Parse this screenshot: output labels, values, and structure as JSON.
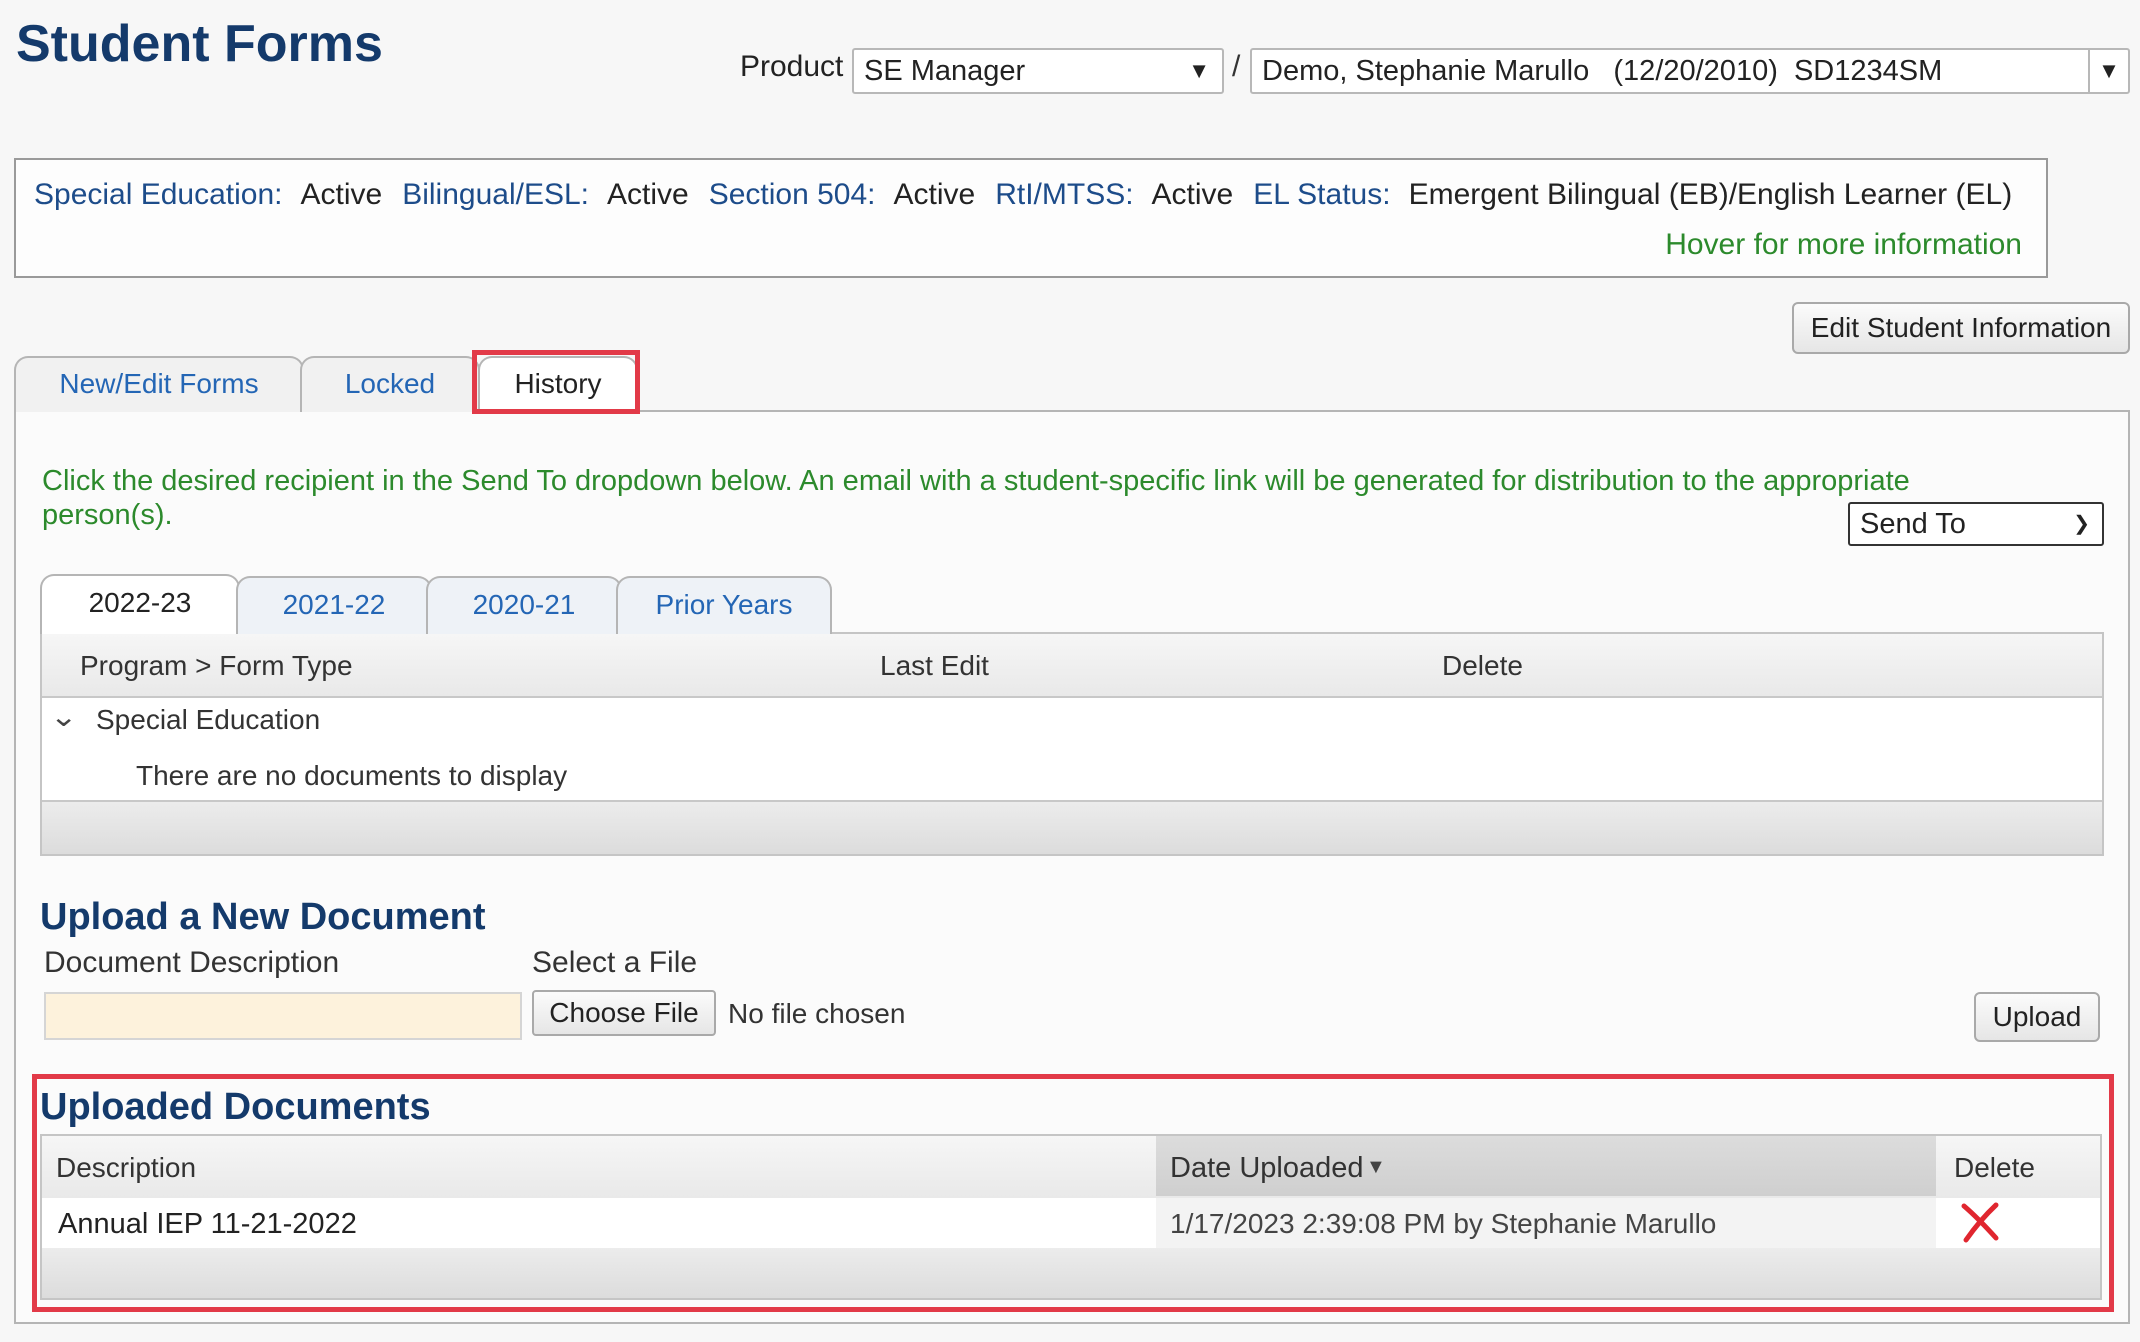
{
  "header": {
    "title": "Student Forms",
    "product_label": "Product",
    "product_value": "SE Manager",
    "separator": "/",
    "student_value": "Demo, Stephanie Marullo   (12/20/2010)  SD1234SM"
  },
  "status": {
    "items": [
      {
        "label": "Special Education:",
        "value": "Active"
      },
      {
        "label": "Bilingual/ESL:",
        "value": "Active"
      },
      {
        "label": "Section 504:",
        "value": "Active"
      },
      {
        "label": "RtI/MTSS:",
        "value": "Active"
      },
      {
        "label": "EL Status:",
        "value": "Emergent Bilingual (EB)/English Learner (EL)"
      }
    ],
    "hover_info": "Hover for more information"
  },
  "buttons": {
    "edit_student": "Edit Student Information",
    "choose_file": "Choose File",
    "upload": "Upload"
  },
  "tabs": {
    "main": [
      "New/Edit Forms",
      "Locked",
      "History"
    ],
    "active": "History",
    "years": [
      "2022-23",
      "2021-22",
      "2020-21",
      "Prior Years"
    ],
    "active_year": "2022-23"
  },
  "instructions": "Click the desired recipient in the Send To dropdown below. An email with a student-specific link will be generated for distribution to the appropriate person(s).",
  "send_to": "Send To",
  "forms_grid": {
    "columns": [
      "Program > Form Type",
      "Last Edit",
      "Delete"
    ],
    "group": "Special Education",
    "empty_message": "There are no documents to display"
  },
  "upload": {
    "title": "Upload a New Document",
    "description_label": "Document Description",
    "file_label": "Select a File",
    "no_file": "No file chosen"
  },
  "uploaded": {
    "title": "Uploaded Documents",
    "columns": [
      "Description",
      "Date Uploaded",
      "Delete"
    ],
    "rows": [
      {
        "description": "Annual IEP 11-21-2022",
        "date": "1/17/2023 2:39:08 PM by Stephanie Marullo"
      }
    ]
  },
  "colors": {
    "title": "#143a6b",
    "link": "#2466b5",
    "green_text": "#2c8a2c",
    "highlight": "#e23a48",
    "input_bg": "#fdf2dc"
  },
  "icons": {
    "sort": "triangle-down",
    "delete": "red-x",
    "expand": "chevron-down"
  }
}
